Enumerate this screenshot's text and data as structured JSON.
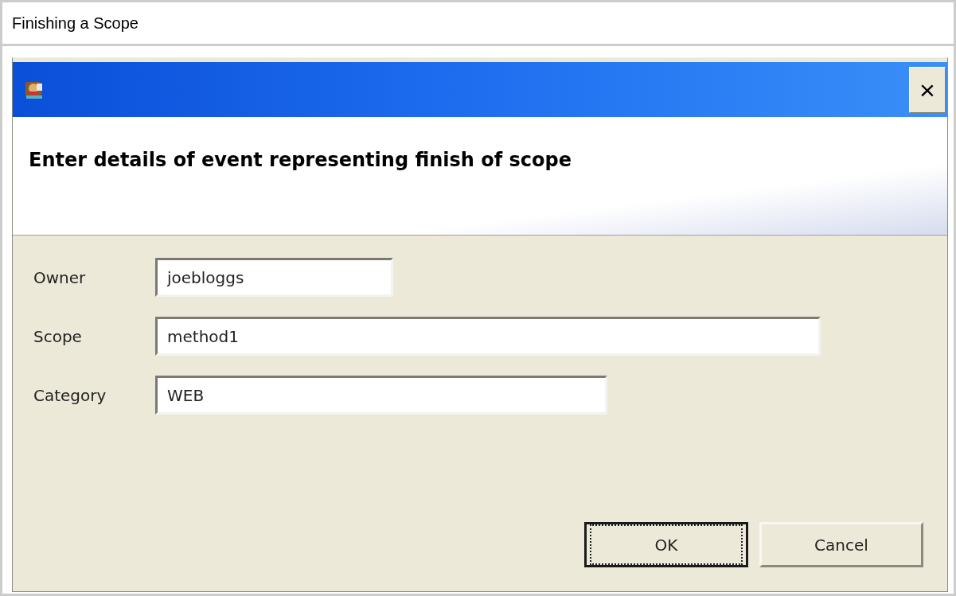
{
  "panel": {
    "title": "Finishing a Scope"
  },
  "dialog": {
    "close_label": "×",
    "heading": "Enter details of event representing finish of scope",
    "fields": [
      {
        "label": "Owner",
        "value": "joebloggs"
      },
      {
        "label": "Scope",
        "value": "method1"
      },
      {
        "label": "Category",
        "value": "WEB"
      }
    ],
    "buttons": [
      {
        "label": "OK",
        "focused": true
      },
      {
        "label": "Cancel",
        "focused": false
      }
    ]
  }
}
